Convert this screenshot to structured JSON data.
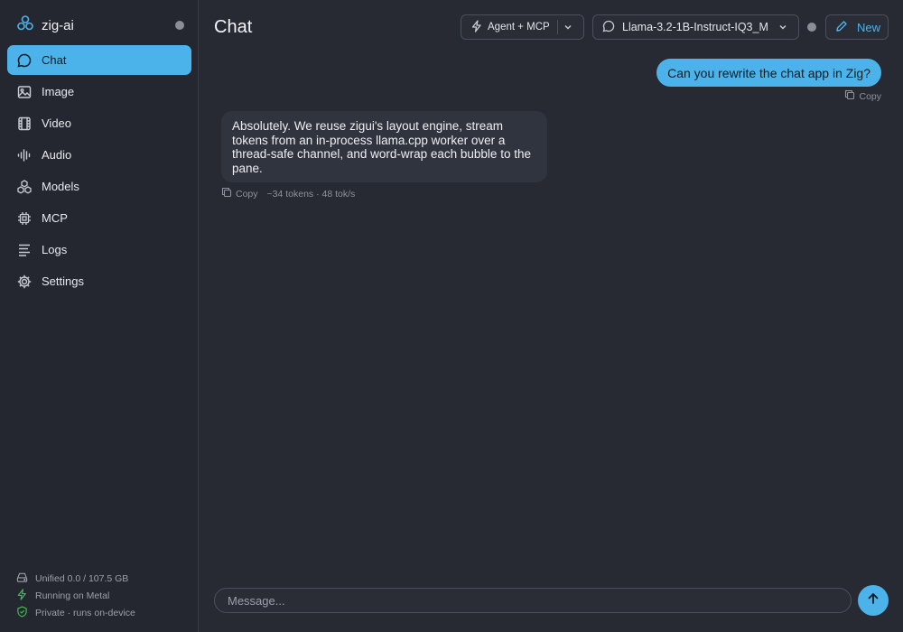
{
  "app": {
    "name": "zig-ai",
    "brand_icon": "zig-logo-icon"
  },
  "sidebar": {
    "items": [
      {
        "label": "Chat",
        "icon": "chat-bubble-icon",
        "active": true
      },
      {
        "label": "Image",
        "icon": "image-icon",
        "active": false
      },
      {
        "label": "Video",
        "icon": "film-icon",
        "active": false
      },
      {
        "label": "Audio",
        "icon": "audio-wave-icon",
        "active": false
      },
      {
        "label": "Models",
        "icon": "cubes-icon",
        "active": false
      },
      {
        "label": "MCP",
        "icon": "chip-icon",
        "active": false
      },
      {
        "label": "Logs",
        "icon": "list-icon",
        "active": false
      },
      {
        "label": "Settings",
        "icon": "gear-icon",
        "active": false
      }
    ],
    "footer": {
      "memory": "Unified 0.0 / 107.5 GB",
      "backend": "Running on Metal",
      "privacy": "Private · runs on-device"
    }
  },
  "header": {
    "title": "Chat",
    "agent_mode": "Agent + MCP",
    "model": "Llama-3.2-1B-Instruct-IQ3_M",
    "new_label": "New"
  },
  "messages": [
    {
      "role": "user",
      "text": "Can you rewrite the chat app in Zig?",
      "copy_label": "Copy"
    },
    {
      "role": "assistant",
      "text": "Absolutely. We reuse zigui's layout engine, stream tokens from an in-process llama.cpp worker over a thread-safe channel, and word-wrap each bubble to the pane.",
      "copy_label": "Copy",
      "stats": "~34 tokens · 48 tok/s"
    }
  ],
  "composer": {
    "placeholder": "Message..."
  },
  "colors": {
    "accent": "#4cb3ea",
    "background": "#272a33",
    "sidebar": "#24272f",
    "assistant_bubble": "#30343e",
    "success": "#3fb950"
  }
}
